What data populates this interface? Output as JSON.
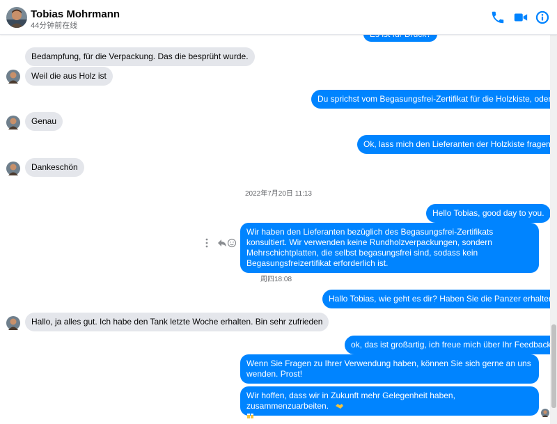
{
  "header": {
    "contact_name": "Tobias Mohrmann",
    "status": "44分钟前在线",
    "accent_color": "#0084ff",
    "icons": [
      "phone-icon",
      "video-camera-icon",
      "info-icon"
    ]
  },
  "messages": {
    "m0": "Es ist für Druck?",
    "m1": "Bedampfung, für die Verpackung. Das die besprüht wurde.",
    "m2": "Weil die aus Holz ist",
    "m3": "Du sprichst vom Begasungsfrei-Zertifikat für die Holzkiste, oder?",
    "m4": "Genau",
    "m5": "Ok, lass mich den Lieferanten der Holzkiste fragen.",
    "m6": "Dankeschön",
    "ts1": "2022年7月20日 11:13",
    "m7": "Hello Tobias, good day to you.",
    "m8": "Wir haben den Lieferanten bezüglich des Begasungsfrei-Zertifikats konsultiert. Wir verwenden keine Rundholzverpackungen, sondern Mehrschichtplatten, die selbst begasungsfrei sind, sodass kein Begasungsfreizertifikat erforderlich ist.",
    "ts2": "周四18:08",
    "m9": "Hallo Tobias, wie geht es dir?  Haben Sie die Panzer erhalten?",
    "m10": "Hallo, ja alles gut. Ich habe den Tank letzte Woche erhalten. Bin sehr zufrieden",
    "m11": "ok, das ist großartig, ich freue mich über Ihr Feedback.",
    "m12": "Wenn Sie Fragen zu Ihrer Verwendung haben, können Sie sich gerne an uns wenden. Prost!",
    "m13": "Wir hoffen, dass wir in Zukunft mehr Gelegenheit haben, zusammenzuarbeiten."
  },
  "colors": {
    "incoming_bubble": "#e4e6eb",
    "outgoing_bubble": "#0084ff"
  }
}
